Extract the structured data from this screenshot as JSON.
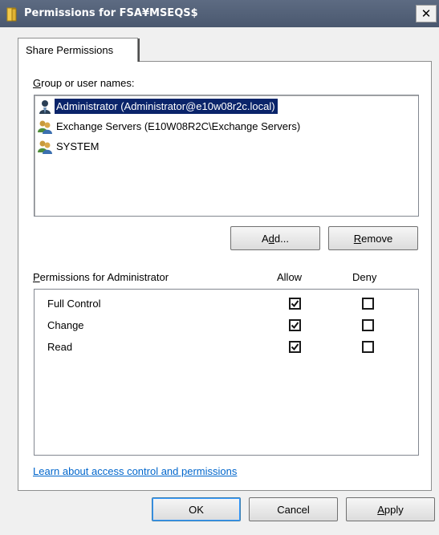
{
  "window": {
    "title": "Permissions for FSA¥MSEQS$",
    "close_label": "✕"
  },
  "tabs": [
    {
      "label": "Share Permissions"
    }
  ],
  "groups": {
    "label_prefix": "",
    "label_underline": "G",
    "label_rest": "roup or user names:",
    "items": [
      {
        "name": "Administrator (Administrator@e10w08r2c.local)",
        "icon": "single-user-icon",
        "selected": true
      },
      {
        "name": "Exchange Servers (E10W08R2C\\Exchange Servers)",
        "icon": "group-users-icon",
        "selected": false
      },
      {
        "name": "SYSTEM",
        "icon": "group-users-icon",
        "selected": false
      }
    ]
  },
  "buttons": {
    "add_pre": "A",
    "add_u": "d",
    "add_post": "d...",
    "remove_pre": "",
    "remove_u": "R",
    "remove_post": "emove",
    "ok": "OK",
    "cancel": "Cancel",
    "apply_pre": "",
    "apply_u": "A",
    "apply_post": "pply"
  },
  "permissions": {
    "label_u": "P",
    "label_rest": "ermissions for Administrator",
    "allow_header": "Allow",
    "deny_header": "Deny",
    "rows": [
      {
        "name": "Full Control",
        "allow": true,
        "deny": false
      },
      {
        "name": "Change",
        "allow": true,
        "deny": false
      },
      {
        "name": "Read",
        "allow": true,
        "deny": false
      }
    ]
  },
  "help_link": "Learn about access control and permissions",
  "colors": {
    "titlebar": "#4f5d75",
    "selection": "#0a246a",
    "link": "#0066cc"
  }
}
